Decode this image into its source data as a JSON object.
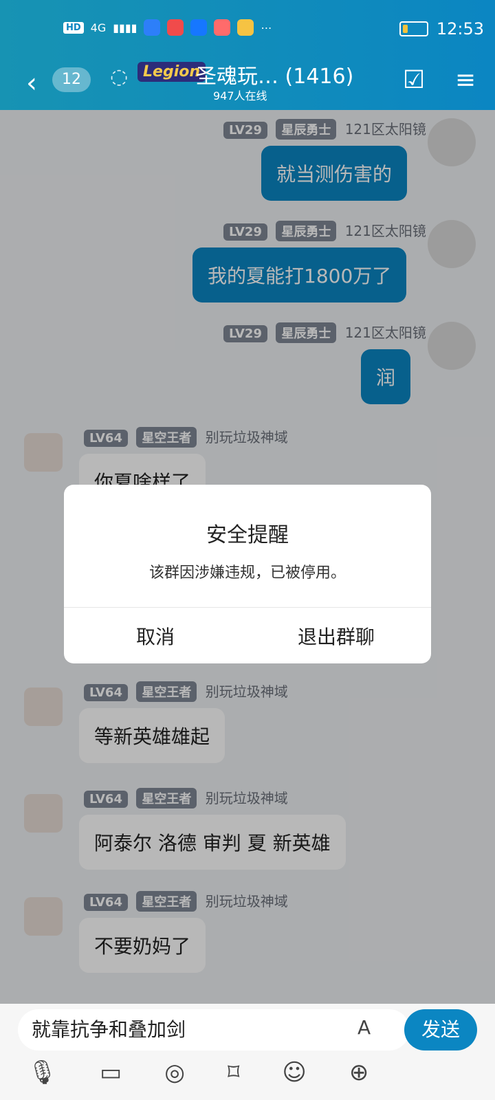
{
  "status_bar": {
    "network": "HD",
    "signal": "4G",
    "time": "12:53"
  },
  "header": {
    "back_icon": "chevron-left-icon",
    "unread_count": "12",
    "group_name": "圣魂玩… (1416)",
    "group_badge": "Legion",
    "online_text": "947人在线"
  },
  "messages": [
    {
      "side": "right",
      "level": "LV29",
      "title": "星辰勇士",
      "name": "121区太阳镜",
      "text": "就当测伤害的"
    },
    {
      "side": "right",
      "level": "LV29",
      "title": "星辰勇士",
      "name": "121区太阳镜",
      "text": "我的夏能打1800万了"
    },
    {
      "side": "right",
      "level": "LV29",
      "title": "星辰勇士",
      "name": "121区太阳镜",
      "text": "润"
    },
    {
      "side": "left",
      "level": "LV64",
      "title": "星空王者",
      "name": "别玩垃圾神域",
      "text": "你夏啥样了"
    },
    {
      "side": "left",
      "level": "LV64",
      "title": "星空王者",
      "name": "别玩垃圾神域",
      "text": "等新英雄雄起"
    },
    {
      "side": "left",
      "level": "LV64",
      "title": "星空王者",
      "name": "别玩垃圾神域",
      "text": "阿泰尔 洛德 审判 夏 新英雄"
    },
    {
      "side": "left",
      "level": "LV64",
      "title": "星空王者",
      "name": "别玩垃圾神域",
      "text": "不要奶妈了"
    }
  ],
  "dialog": {
    "title": "安全提醒",
    "message": "该群因涉嫌违规，已被停用。",
    "cancel": "取消",
    "exit": "退出群聊"
  },
  "input": {
    "text": "就靠抗争和叠加剑",
    "send": "发送"
  },
  "colors": {
    "accent": "#0b86c2",
    "header_gradient_start": "#1793b3"
  }
}
